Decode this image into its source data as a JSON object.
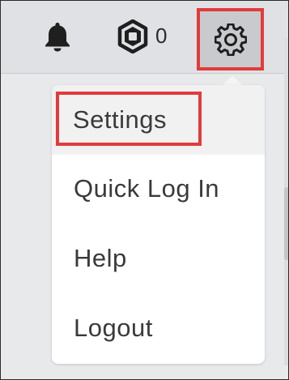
{
  "header": {
    "robux_count": "0",
    "icons": {
      "notifications": "bell-icon",
      "currency": "robux-icon",
      "settings": "gear-icon"
    }
  },
  "dropdown": {
    "items": [
      {
        "label": "Settings",
        "highlighted": true
      },
      {
        "label": "Quick Log In"
      },
      {
        "label": "Help"
      },
      {
        "label": "Logout"
      }
    ]
  },
  "colors": {
    "highlight_outline": "#e23b3b",
    "topbar": "#dfe1e4",
    "menu_bg": "#ffffff",
    "text": "#3a3a3a"
  }
}
